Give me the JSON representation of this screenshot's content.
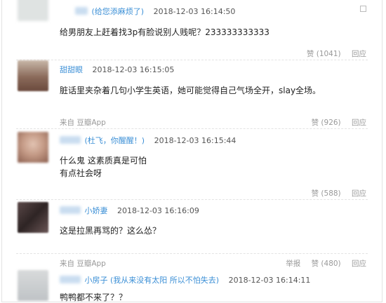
{
  "comments": [
    {
      "user_note": "(给您添麻烦了)",
      "time": "2018-12-03 16:14:50",
      "text_lines": [
        "给男朋友上赶着找3p有脸说别人贱呢？233333333333"
      ],
      "source": "",
      "report": "",
      "like": "赞 (1041)",
      "reply": "回应",
      "avatar_color": "#dfe3e2"
    },
    {
      "username": "甜甜眼",
      "time": "2018-12-03 16:15:05",
      "text_lines": [
        "脏话里夹杂着几句小学生英语，她可能觉得自己气场全开，slay全场。"
      ],
      "source": "来自 豆瓣App",
      "report": "",
      "like": "赞 (926)",
      "reply": "回应",
      "avatar_color": "#8a6a5a"
    },
    {
      "user_note": "(杜飞，你醒醒！)",
      "time": "2018-12-03 16:15:44",
      "text_lines": [
        "什么鬼 这素质真是可怕",
        "有点社会呀"
      ],
      "source": "",
      "report": "",
      "like": "赞 (588)",
      "reply": "回应",
      "avatar_color": "#c49a86"
    },
    {
      "username": "小娇妻",
      "time": "2018-12-03 16:16:09",
      "text_lines": [
        "这是拉黑再骂的？这么怂？"
      ],
      "source": "",
      "report": "",
      "like": "",
      "reply": "",
      "avatar_color": "#3a3030"
    },
    {
      "username": "小房子",
      "user_note": "(我从来没有太阳 所以不怕失去)",
      "time": "2018-12-03 16:14:11",
      "text_lines": [
        "鸭鸭都不来了？？"
      ],
      "source": "来自 豆瓣App",
      "report": "举报",
      "like": "赞 (480)",
      "reply": "回应",
      "avatar_color": "#bfc3c6"
    }
  ]
}
